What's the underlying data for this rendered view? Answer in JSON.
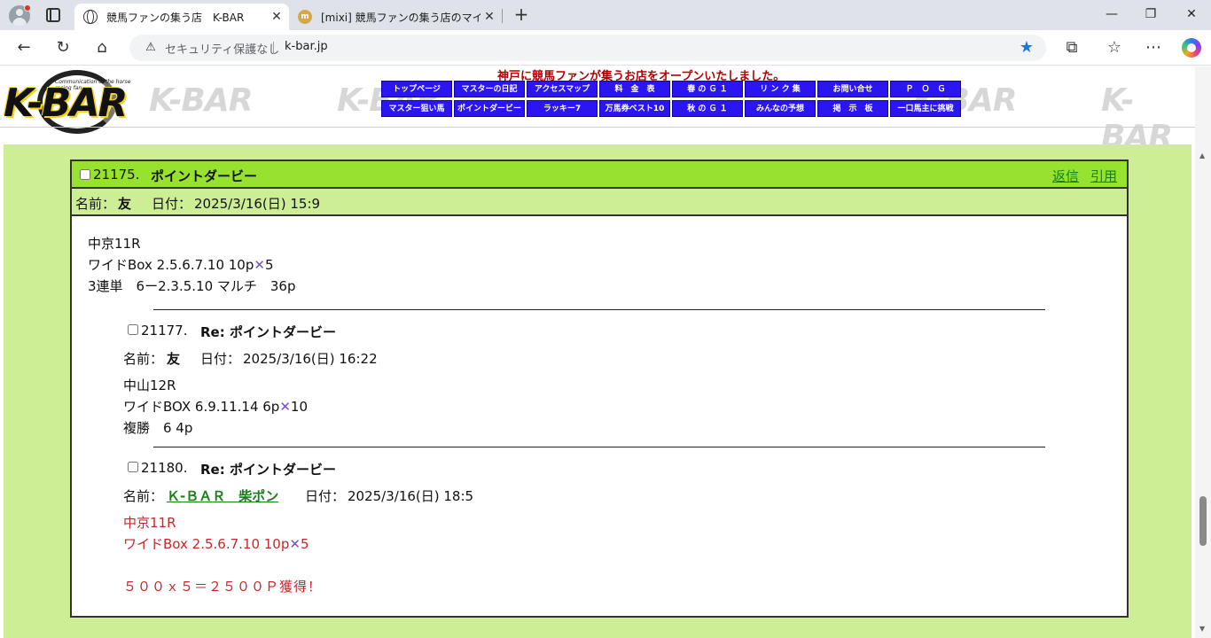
{
  "browser": {
    "tabs": [
      {
        "title": "競馬ファンの集う店　K-BAR",
        "favicon": "globe-icon",
        "active": true
      },
      {
        "title": "[mixi] 競馬ファンの集う店のマイミク一",
        "favicon": "mixi-icon",
        "active": false
      }
    ],
    "address": {
      "security_label": "セキュリティ保護なし",
      "url": "k-bar.jp"
    },
    "accent_color": "#1a73e8"
  },
  "site": {
    "logo_text": "K-BAR",
    "logo_tagline": "Communication of the horse racing fan",
    "watermark_text": "K-BAR",
    "tagline": "神戸に競馬ファンが集うお店をオープンいたしました。",
    "nav": [
      "トップページ",
      "マスターの日記",
      "アクセスマップ",
      "料　金　表",
      "春 の Ｇ １",
      "リ ン ク 集",
      "お問い合せ",
      "Ｐ　Ｏ　Ｇ",
      "マスター狙い馬",
      "ポイントダービー",
      "ラッキー7",
      "万馬券ベスト10",
      "秋 の Ｇ １",
      "みんなの予想",
      "掲　示　板",
      "一口馬主に挑戦"
    ],
    "colors": {
      "nav_bg": "#2b16f2",
      "page_bg": "#cdee94",
      "post_header_bg": "#96e22f",
      "tagline": "#b30000"
    }
  },
  "post": {
    "number": "21175.",
    "subject": "ポイントダービー",
    "reply_label": "返信",
    "quote_label": "引用",
    "name_label": "名前：",
    "author": "友",
    "date_label": "日付：",
    "date": "2025/3/16(日) 15:9",
    "body": [
      "中京11R",
      "ワイドBox 2.5.6.7.10 10p",
      "✕",
      "5",
      "3連単　6ー2.3.5.10 マルチ　36p"
    ],
    "replies": [
      {
        "number": "21177.",
        "subject": "Re: ポイントダービー",
        "name_label": "名前：",
        "author": "友",
        "date_label": "日付：",
        "date": "2025/3/16(日) 16:22",
        "body": [
          "中山12R",
          "ワイドBOX 6.9.11.14 6p",
          "✕",
          "10",
          "複勝　6 4p"
        ]
      },
      {
        "number": "21180.",
        "subject": "Re: ポイントダービー",
        "name_label": "名前：",
        "author": "Ｋ-ＢＡＲ　柴ポン",
        "date_label": "日付：",
        "date": "2025/3/16(日) 18:5",
        "body": [
          "中京11R",
          "ワイドBox 2.5.6.7.10 10p",
          "✕",
          "5",
          "５００ｘ５＝２５００Ｐ獲得！"
        ],
        "body_color": "#c8262b"
      }
    ]
  }
}
